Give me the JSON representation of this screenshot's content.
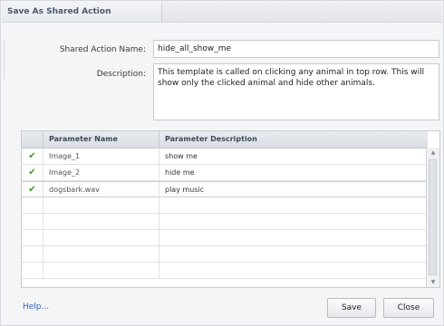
{
  "dialog": {
    "title": "Save As Shared Action"
  },
  "form": {
    "name_label": "Shared Action Name:",
    "name_value": "hide_all_show_me",
    "desc_label": "Description:",
    "desc_value": "This template is called on clicking any animal in top row. This will show only the clicked animal and hide other animals."
  },
  "table": {
    "columns": [
      "",
      "Parameter Name",
      "Parameter Description"
    ],
    "rows": [
      {
        "check": "✔",
        "name": "Image_1",
        "description": "show me"
      },
      {
        "check": "✔",
        "name": "Image_2",
        "description": "hide me"
      },
      {
        "check": "✔",
        "name": "dogsbark.wav",
        "description": "play music"
      }
    ],
    "check_color": "#3b9b1e"
  },
  "footer": {
    "help_label": "Help...",
    "save_label": "Save",
    "close_label": "Close"
  },
  "colors": {
    "accent": "#2f62b3",
    "title": "#4a5a6e"
  }
}
